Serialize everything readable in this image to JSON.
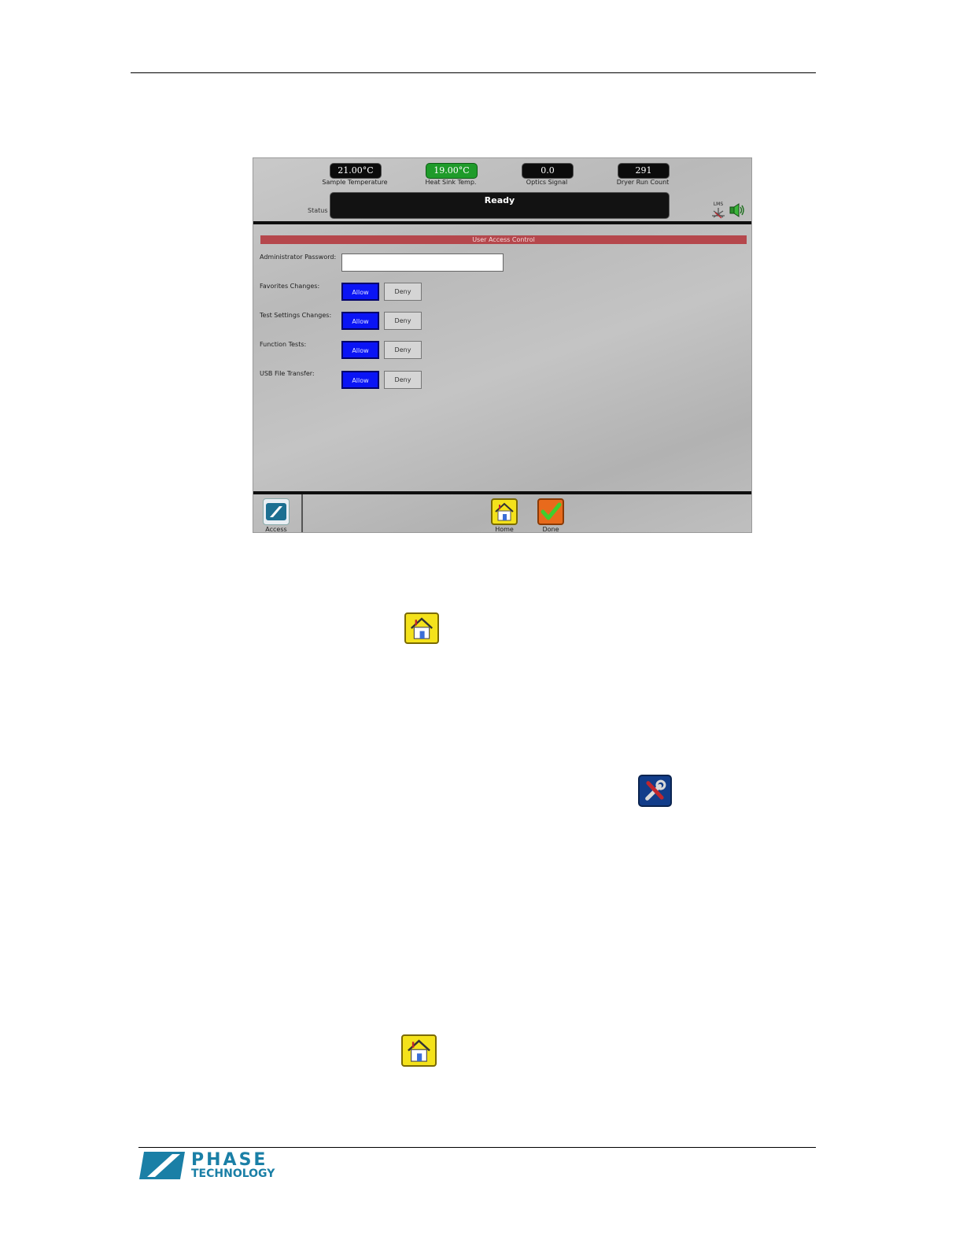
{
  "readouts": [
    {
      "value": "21.00°C",
      "label": "Sample Temperature"
    },
    {
      "value": "19.00°C",
      "label": "Heat Sink Temp."
    },
    {
      "value": "0.0",
      "label": "Optics Signal"
    },
    {
      "value": "291",
      "label": "Dryer Run Count"
    }
  ],
  "status": {
    "label": "Status",
    "value": "Ready"
  },
  "lms_label": "LMS",
  "section_title": "User Access Control",
  "rows": [
    {
      "label": "Administrator Password:"
    },
    {
      "label": "Favorites Changes:",
      "allow": "Allow",
      "deny": "Deny"
    },
    {
      "label": "Test Settings Changes:",
      "allow": "Allow",
      "deny": "Deny"
    },
    {
      "label": "Function Tests:",
      "allow": "Allow",
      "deny": "Deny"
    },
    {
      "label": "USB File Transfer:",
      "allow": "Allow",
      "deny": "Deny"
    }
  ],
  "toolbar": {
    "access": "Access",
    "home": "Home",
    "done": "Done"
  },
  "colors": {
    "allow_selected": "#0a14f5",
    "heat_sink_ok": "#1f9b2a",
    "section_header": "#b5474c",
    "brand": "#1a7fa6"
  },
  "icons": [
    "home-icon",
    "tools-icon",
    "checkmark-icon",
    "access-icon",
    "speaker-icon",
    "lms-icon"
  ],
  "logo": {
    "line1": "PHASE",
    "line2": "TECHNOLOGY"
  }
}
